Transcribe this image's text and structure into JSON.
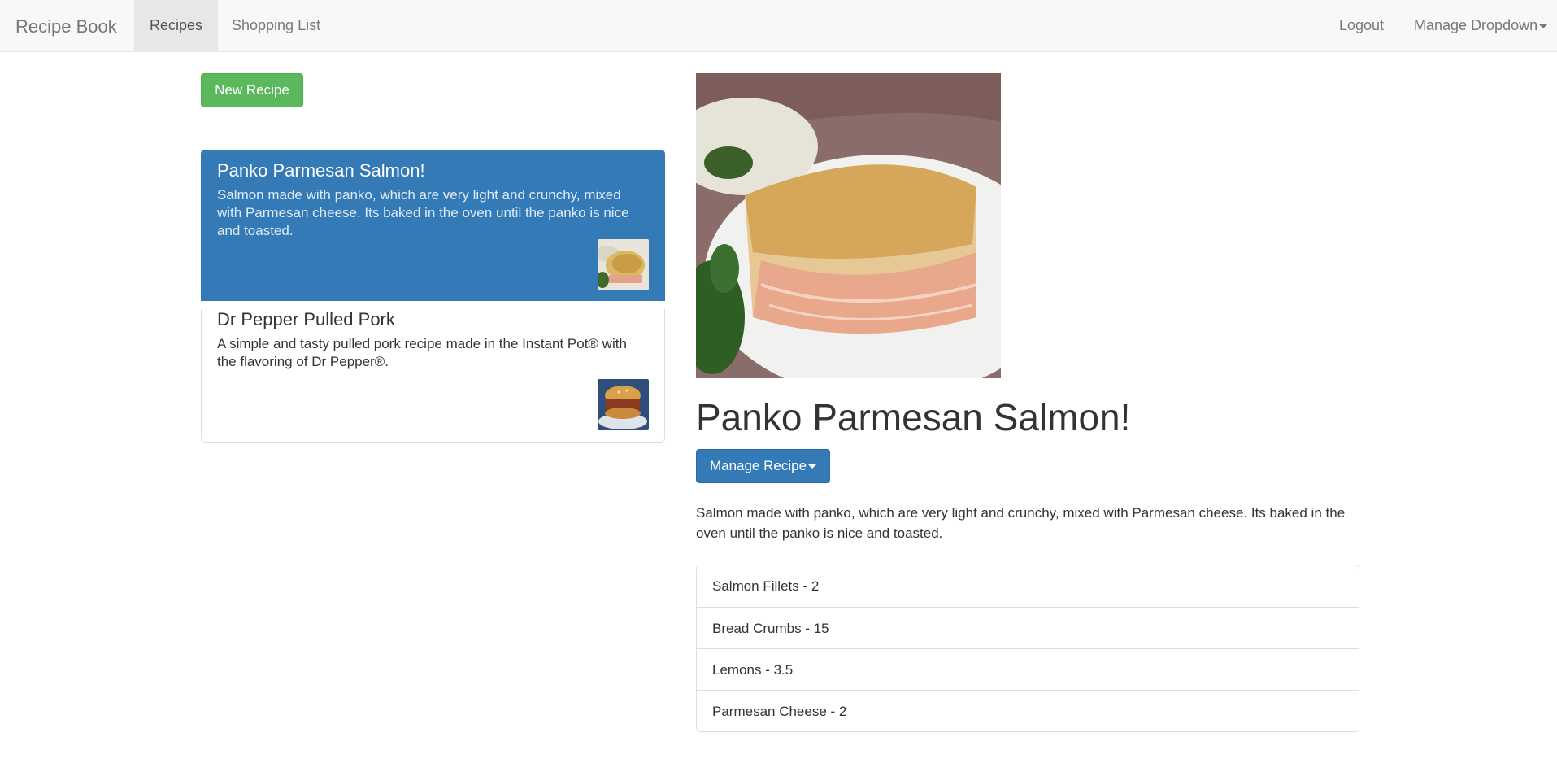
{
  "navbar": {
    "brand": "Recipe Book",
    "tabs": [
      "Recipes",
      "Shopping List"
    ],
    "logout": "Logout",
    "manage": "Manage Dropdown"
  },
  "sidebar": {
    "new_recipe": "New Recipe",
    "recipes": [
      {
        "name": "Panko Parmesan Salmon!",
        "description": "Salmon made with panko, which are very light and crunchy, mixed with Parmesan cheese. Its baked in the oven until the panko is nice and toasted."
      },
      {
        "name": "Dr Pepper Pulled Pork",
        "description": "A simple and tasty pulled pork recipe made in the Instant Pot® with the flavoring of Dr Pepper®."
      }
    ]
  },
  "detail": {
    "title": "Panko Parmesan Salmon!",
    "manage_button": "Manage Recipe",
    "description": "Salmon made with panko, which are very light and crunchy, mixed with Parmesan cheese. Its baked in the oven until the panko is nice and toasted.",
    "ingredients": [
      "Salmon Fillets - 2",
      "Bread Crumbs - 15",
      "Lemons - 3.5",
      "Parmesan Cheese - 2"
    ]
  },
  "colors": {
    "primary": "#337ab7",
    "success": "#5cb85c",
    "navbar_bg": "#f8f8f8"
  }
}
